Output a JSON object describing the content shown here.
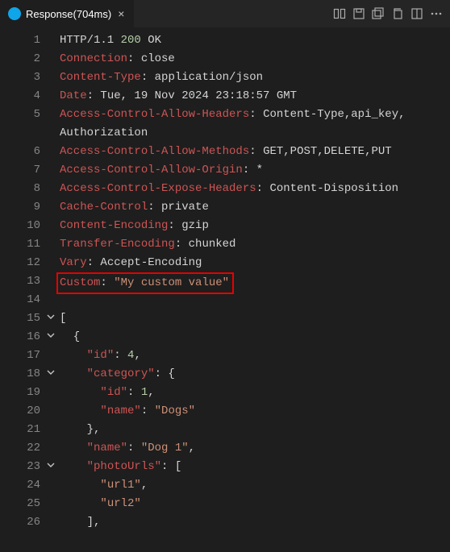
{
  "tab": {
    "title": "Response(704ms)"
  },
  "lines": [
    {
      "n": 1,
      "fold": "",
      "segs": [
        [
          "prot",
          "HTTP/1.1 "
        ],
        [
          "num",
          "200"
        ],
        [
          "prot",
          " OK"
        ]
      ]
    },
    {
      "n": 2,
      "fold": "",
      "segs": [
        [
          "hk",
          "Connection"
        ],
        [
          "pun",
          ": "
        ],
        [
          "hv",
          "close"
        ]
      ]
    },
    {
      "n": 3,
      "fold": "",
      "segs": [
        [
          "hk",
          "Content-Type"
        ],
        [
          "pun",
          ": "
        ],
        [
          "hv",
          "application/json"
        ]
      ]
    },
    {
      "n": 4,
      "fold": "",
      "segs": [
        [
          "hk",
          "Date"
        ],
        [
          "pun",
          ": "
        ],
        [
          "hv",
          "Tue, 19 Nov 2024 23:18:57 GMT"
        ]
      ]
    },
    {
      "n": 5,
      "fold": "",
      "segs": [
        [
          "hk",
          "Access-Control-Allow-Headers"
        ],
        [
          "pun",
          ": "
        ],
        [
          "hv",
          "Content-Type,api_key,"
        ]
      ]
    },
    {
      "n": "",
      "fold": "",
      "segs": [
        [
          "hv",
          "Authorization"
        ]
      ]
    },
    {
      "n": 6,
      "fold": "",
      "segs": [
        [
          "hk",
          "Access-Control-Allow-Methods"
        ],
        [
          "pun",
          ": "
        ],
        [
          "hv",
          "GET,POST,DELETE,PUT"
        ]
      ]
    },
    {
      "n": 7,
      "fold": "",
      "segs": [
        [
          "hk",
          "Access-Control-Allow-Origin"
        ],
        [
          "pun",
          ": "
        ],
        [
          "hv",
          "*"
        ]
      ]
    },
    {
      "n": 8,
      "fold": "",
      "segs": [
        [
          "hk",
          "Access-Control-Expose-Headers"
        ],
        [
          "pun",
          ": "
        ],
        [
          "hv",
          "Content-Disposition"
        ]
      ]
    },
    {
      "n": 9,
      "fold": "",
      "segs": [
        [
          "hk",
          "Cache-Control"
        ],
        [
          "pun",
          ": "
        ],
        [
          "hv",
          "private"
        ]
      ]
    },
    {
      "n": 10,
      "fold": "",
      "segs": [
        [
          "hk",
          "Content-Encoding"
        ],
        [
          "pun",
          ": "
        ],
        [
          "hv",
          "gzip"
        ]
      ]
    },
    {
      "n": 11,
      "fold": "",
      "segs": [
        [
          "hk",
          "Transfer-Encoding"
        ],
        [
          "pun",
          ": "
        ],
        [
          "hv",
          "chunked"
        ]
      ]
    },
    {
      "n": 12,
      "fold": "",
      "segs": [
        [
          "hk",
          "Vary"
        ],
        [
          "pun",
          ": "
        ],
        [
          "hv",
          "Accept-Encoding"
        ]
      ]
    },
    {
      "n": 13,
      "fold": "",
      "hl": true,
      "segs": [
        [
          "hk",
          "Custom"
        ],
        [
          "pun",
          ": "
        ],
        [
          "str",
          "\"My custom value\""
        ]
      ]
    },
    {
      "n": 14,
      "fold": "",
      "segs": [
        [
          "pun",
          ""
        ]
      ]
    },
    {
      "n": 15,
      "fold": "v",
      "segs": [
        [
          "pun",
          "["
        ]
      ]
    },
    {
      "n": 16,
      "fold": "v",
      "segs": [
        [
          "pun",
          "  {"
        ]
      ]
    },
    {
      "n": 17,
      "fold": "",
      "segs": [
        [
          "pun",
          "    "
        ],
        [
          "hk",
          "\"id\""
        ],
        [
          "pun",
          ": "
        ],
        [
          "num",
          "4"
        ],
        [
          "pun",
          ","
        ]
      ]
    },
    {
      "n": 18,
      "fold": "v",
      "segs": [
        [
          "pun",
          "    "
        ],
        [
          "hk",
          "\"category\""
        ],
        [
          "pun",
          ": {"
        ]
      ]
    },
    {
      "n": 19,
      "fold": "",
      "segs": [
        [
          "pun",
          "      "
        ],
        [
          "hk",
          "\"id\""
        ],
        [
          "pun",
          ": "
        ],
        [
          "num",
          "1"
        ],
        [
          "pun",
          ","
        ]
      ]
    },
    {
      "n": 20,
      "fold": "",
      "segs": [
        [
          "pun",
          "      "
        ],
        [
          "hk",
          "\"name\""
        ],
        [
          "pun",
          ": "
        ],
        [
          "str",
          "\"Dogs\""
        ]
      ]
    },
    {
      "n": 21,
      "fold": "",
      "segs": [
        [
          "pun",
          "    },"
        ]
      ]
    },
    {
      "n": 22,
      "fold": "",
      "segs": [
        [
          "pun",
          "    "
        ],
        [
          "hk",
          "\"name\""
        ],
        [
          "pun",
          ": "
        ],
        [
          "str",
          "\"Dog 1\""
        ],
        [
          "pun",
          ","
        ]
      ]
    },
    {
      "n": 23,
      "fold": "v",
      "segs": [
        [
          "pun",
          "    "
        ],
        [
          "hk",
          "\"photoUrls\""
        ],
        [
          "pun",
          ": ["
        ]
      ]
    },
    {
      "n": 24,
      "fold": "",
      "segs": [
        [
          "pun",
          "      "
        ],
        [
          "str",
          "\"url1\""
        ],
        [
          "pun",
          ","
        ]
      ]
    },
    {
      "n": 25,
      "fold": "",
      "segs": [
        [
          "pun",
          "      "
        ],
        [
          "str",
          "\"url2\""
        ]
      ]
    },
    {
      "n": 26,
      "fold": "",
      "segs": [
        [
          "pun",
          "    ],"
        ]
      ]
    }
  ]
}
